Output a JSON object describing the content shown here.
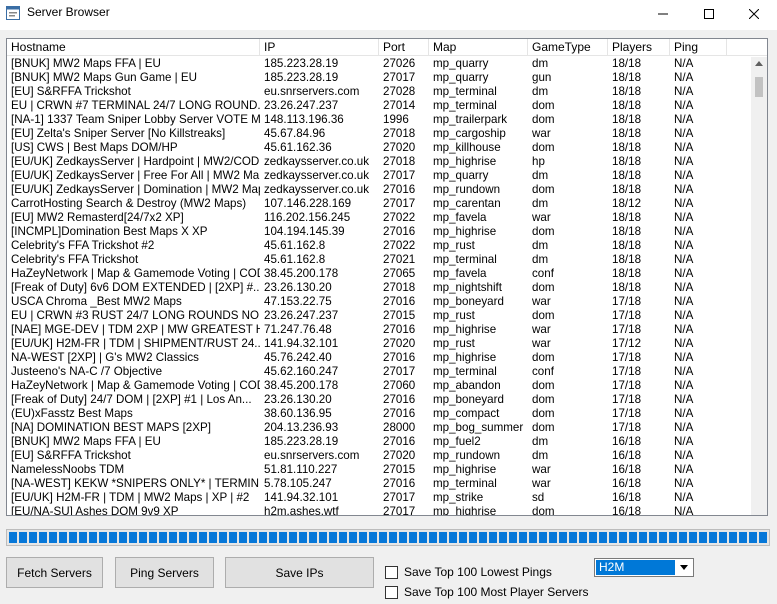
{
  "window": {
    "title": "Server Browser"
  },
  "columns": [
    "Hostname",
    "IP",
    "Port",
    "Map",
    "GameType",
    "Players",
    "Ping"
  ],
  "rows": [
    [
      "[BNUK] MW2 Maps FFA | EU",
      "185.223.28.19",
      "27026",
      "mp_quarry",
      "dm",
      "18/18",
      "N/A"
    ],
    [
      "[BNUK] MW2 Maps Gun Game | EU",
      "185.223.28.19",
      "27017",
      "mp_quarry",
      "gun",
      "18/18",
      "N/A"
    ],
    [
      "[EU] S&RFFA Trickshot",
      "eu.snrservers.com",
      "27028",
      "mp_terminal",
      "dm",
      "18/18",
      "N/A"
    ],
    [
      "EU | CRWN #7 TERMINAL 24/7 LONG ROUND...",
      "23.26.247.237",
      "27014",
      "mp_terminal",
      "dom",
      "18/18",
      "N/A"
    ],
    [
      "[NA-1] 1337 Team Sniper Lobby Server VOTE M...",
      "148.113.196.36",
      "1996",
      "mp_trailerpark",
      "dom",
      "18/18",
      "N/A"
    ],
    [
      "[EU] Zelta's Sniper Server [No Killstreaks]",
      "45.67.84.96",
      "27018",
      "mp_cargoship",
      "war",
      "18/18",
      "N/A"
    ],
    [
      "[US] CWS | Best Maps DOM/HP",
      "45.61.162.36",
      "27020",
      "mp_killhouse",
      "dom",
      "18/18",
      "N/A"
    ],
    [
      "[EU/UK] ZedkaysServer | Hardpoint | MW2/COD...",
      "zedkaysserver.co.uk",
      "27018",
      "mp_highrise",
      "hp",
      "18/18",
      "N/A"
    ],
    [
      "[EU/UK] ZedkaysServer | Free For All | MW2 Map...",
      "zedkaysserver.co.uk",
      "27017",
      "mp_quarry",
      "dm",
      "18/18",
      "N/A"
    ],
    [
      "[EU/UK] ZedkaysServer | Domination | MW2 Map...",
      "zedkaysserver.co.uk",
      "27016",
      "mp_rundown",
      "dom",
      "18/18",
      "N/A"
    ],
    [
      "CarrotHosting Search & Destroy (MW2 Maps)",
      "107.146.228.169",
      "27017",
      "mp_carentan",
      "dm",
      "18/12",
      "N/A"
    ],
    [
      "[EU] MW2 Remasterd[24/7x2 XP]",
      "116.202.156.245",
      "27022",
      "mp_favela",
      "war",
      "18/18",
      "N/A"
    ],
    [
      "[INCMPL]Domination Best Maps X XP",
      "104.194.145.39",
      "27016",
      "mp_highrise",
      "dom",
      "18/18",
      "N/A"
    ],
    [
      "Celebrity's FFA Trickshot #2",
      "45.61.162.8",
      "27022",
      "mp_rust",
      "dm",
      "18/18",
      "N/A"
    ],
    [
      "Celebrity's FFA Trickshot",
      "45.61.162.8",
      "27021",
      "mp_terminal",
      "dm",
      "18/18",
      "N/A"
    ],
    [
      "HaZeyNetwork | Map & Gamemode Voting | COD...",
      "38.45.200.178",
      "27065",
      "mp_favela",
      "conf",
      "18/18",
      "N/A"
    ],
    [
      "[Freak of Duty]  6v6 DOM EXTENDED |  [2XP]  #...",
      "23.26.130.20",
      "27018",
      "mp_nightshift",
      "dom",
      "18/18",
      "N/A"
    ],
    [
      "USCA  Chroma  _Best MW2 Maps",
      "47.153.22.75",
      "27016",
      "mp_boneyard",
      "war",
      "17/18",
      "N/A"
    ],
    [
      "EU | CRWN #3 RUST 24/7 LONG ROUNDS NO...",
      "23.26.247.237",
      "27015",
      "mp_rust",
      "dom",
      "17/18",
      "N/A"
    ],
    [
      "[NAE] MGE-DEV | TDM 2XP | MW GREATEST H...",
      "71.247.76.48",
      "27016",
      "mp_highrise",
      "war",
      "17/18",
      "N/A"
    ],
    [
      "[EU/UK] H2M-FR | TDM | SHIPMENT/RUST 24...",
      "141.94.32.101",
      "27020",
      "mp_rust",
      "war",
      "17/12",
      "N/A"
    ],
    [
      "NA-WEST [2XP] | G's MW2 Classics",
      "45.76.242.40",
      "27016",
      "mp_highrise",
      "dom",
      "17/18",
      "N/A"
    ],
    [
      "Justeeno's NA-C /7 Objective",
      "45.62.160.247",
      "27017",
      "mp_terminal",
      "conf",
      "17/18",
      "N/A"
    ],
    [
      "HaZeyNetwork | Map & Gamemode Voting | COD...",
      "38.45.200.178",
      "27060",
      "mp_abandon",
      "dom",
      "17/18",
      "N/A"
    ],
    [
      "[Freak of Duty]  24/7 DOM |  [2XP]  #1  |  Los An...",
      "23.26.130.20",
      "27016",
      "mp_boneyard",
      "dom",
      "17/18",
      "N/A"
    ],
    [
      "(EU)xFasstz Best Maps",
      "38.60.136.95",
      "27016",
      "mp_compact",
      "dom",
      "17/18",
      "N/A"
    ],
    [
      "[NA] DOMINATION BEST MAPS [2XP]",
      "204.13.236.93",
      "28000",
      "mp_bog_summer",
      "dom",
      "17/18",
      "N/A"
    ],
    [
      "[BNUK] MW2 Maps FFA | EU",
      "185.223.28.19",
      "27016",
      "mp_fuel2",
      "dm",
      "16/18",
      "N/A"
    ],
    [
      "[EU] S&RFFA Trickshot",
      "eu.snrservers.com",
      "27020",
      "mp_rundown",
      "dm",
      "16/18",
      "N/A"
    ],
    [
      "NamelessNoobs TDM",
      "51.81.110.227",
      "27015",
      "mp_highrise",
      "war",
      "16/18",
      "N/A"
    ],
    [
      "[NA-WEST] KEKW *SNIPERS ONLY* | TERMIN...",
      "5.78.105.247",
      "27016",
      "mp_terminal",
      "war",
      "16/18",
      "N/A"
    ],
    [
      "[EU/UK] H2M-FR | TDM | MW2 Maps | XP | #2",
      "141.94.32.101",
      "27017",
      "mp_strike",
      "sd",
      "16/18",
      "N/A"
    ],
    [
      "[EU/NA-SU] Ashes DOM 9v9 XP",
      "h2m.ashes.wtf",
      "27017",
      "mp_highrise",
      "dom",
      "16/18",
      "N/A"
    ]
  ],
  "progress": {
    "value_percent": 100,
    "color": "#0677d8"
  },
  "buttons": {
    "fetch": "Fetch Servers",
    "ping": "Ping Servers",
    "save": "Save IPs"
  },
  "checkboxes": {
    "lowest_pings": "Save Top 100 Lowest Pings",
    "most_players": "Save Top 100 Most Player Servers"
  },
  "game_select": {
    "value": "H2M"
  },
  "colors": {
    "accent": "#0078d7"
  }
}
